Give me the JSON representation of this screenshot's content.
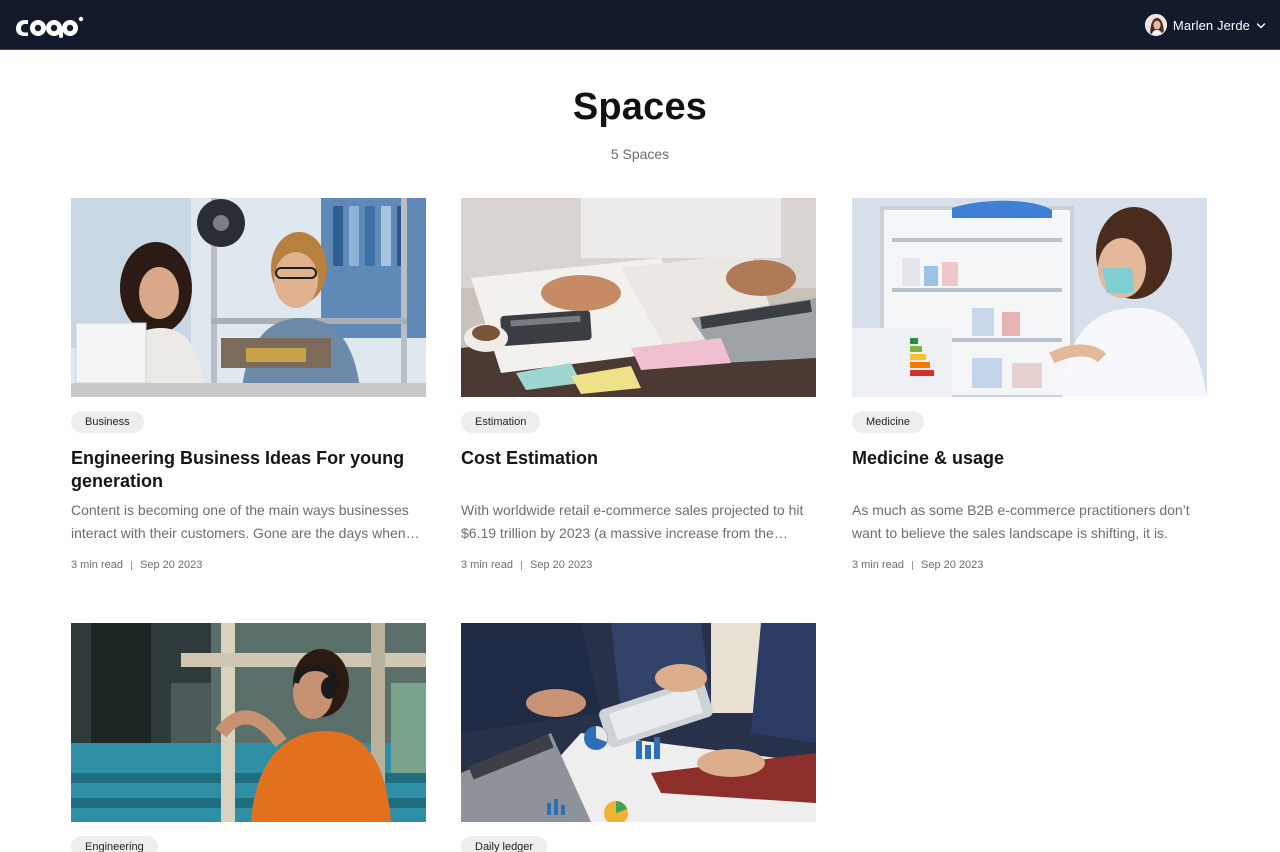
{
  "header": {
    "logo_alt": "logo",
    "user_name": "Marlen Jerde"
  },
  "page": {
    "title": "Spaces",
    "count_label": "5 Spaces"
  },
  "cards": [
    {
      "tag": "Business",
      "title": "Engineering Business Ideas For young generation",
      "description": "Content is becoming one of the main ways businesses interact with their customers. Gone are the days when brands could rely on advertising alone.",
      "read_time": "3 min read",
      "date": "Sep 20 2023",
      "image": "engineers-3d-printer-photo"
    },
    {
      "tag": "Estimation",
      "title": "Cost Estimation",
      "description": "With worldwide retail e-commerce sales projected to hit $6.19 trillion by 2023 (a massive increase from the previous years).",
      "read_time": "3 min read",
      "date": "Sep 20 2023",
      "image": "calculator-paperwork-photo"
    },
    {
      "tag": "Medicine",
      "title": "Medicine & usage",
      "description": "As much as some B2B e-commerce practitioners don’t want to believe the sales landscape is shifting, it is.",
      "read_time": "3 min read",
      "date": "Sep 20 2023",
      "image": "pharmacist-cabinet-photo"
    },
    {
      "tag": "Engineering",
      "title": "",
      "description": "",
      "read_time": "",
      "date": "",
      "image": "industrial-engineer-photo"
    },
    {
      "tag": "Daily ledger",
      "title": "",
      "description": "",
      "read_time": "",
      "date": "",
      "image": "business-charts-tablet-photo"
    }
  ],
  "colors": {
    "header_bg": "#121a2c",
    "tag_bg": "#eeeeee",
    "text_muted": "#6e6e6e"
  }
}
